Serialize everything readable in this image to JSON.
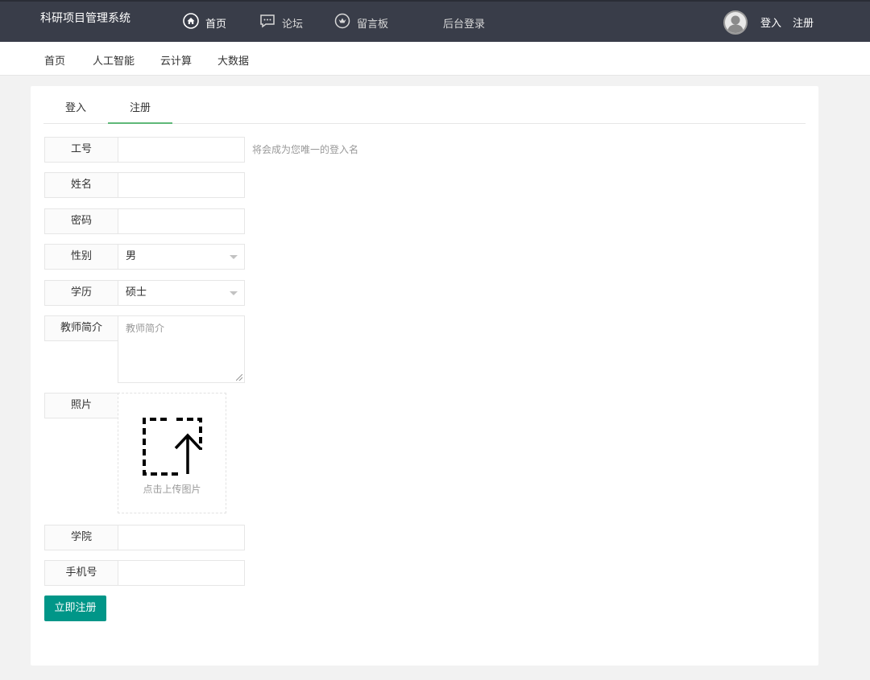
{
  "app": {
    "title": "科研项目管理系统"
  },
  "topnav": {
    "items": [
      {
        "label": "首页",
        "icon": "home-icon"
      },
      {
        "label": "论坛",
        "icon": "chat-icon"
      },
      {
        "label": "留言板",
        "icon": "message-board-icon"
      },
      {
        "label": "后台登录"
      }
    ],
    "login": "登入",
    "register": "注册"
  },
  "subnav": {
    "items": [
      "首页",
      "人工智能",
      "云计算",
      "大数据"
    ]
  },
  "tabs": {
    "login": "登入",
    "register": "注册",
    "active": "注册"
  },
  "form": {
    "id_label": "工号",
    "id_value": "",
    "id_hint": "将会成为您唯一的登入名",
    "name_label": "姓名",
    "name_value": "",
    "password_label": "密码",
    "password_value": "",
    "gender_label": "性别",
    "gender_value": "男",
    "education_label": "学历",
    "education_value": "硕士",
    "intro_label": "教师简介",
    "intro_placeholder": "教师简介",
    "photo_label": "照片",
    "photo_upload_text": "点击上传图片",
    "college_label": "学院",
    "college_value": "",
    "phone_label": "手机号",
    "phone_value": "",
    "submit_label": "立即注册"
  },
  "colors": {
    "topbar": "#393d49",
    "tab_active": "#5fb878",
    "submit": "#009688"
  }
}
